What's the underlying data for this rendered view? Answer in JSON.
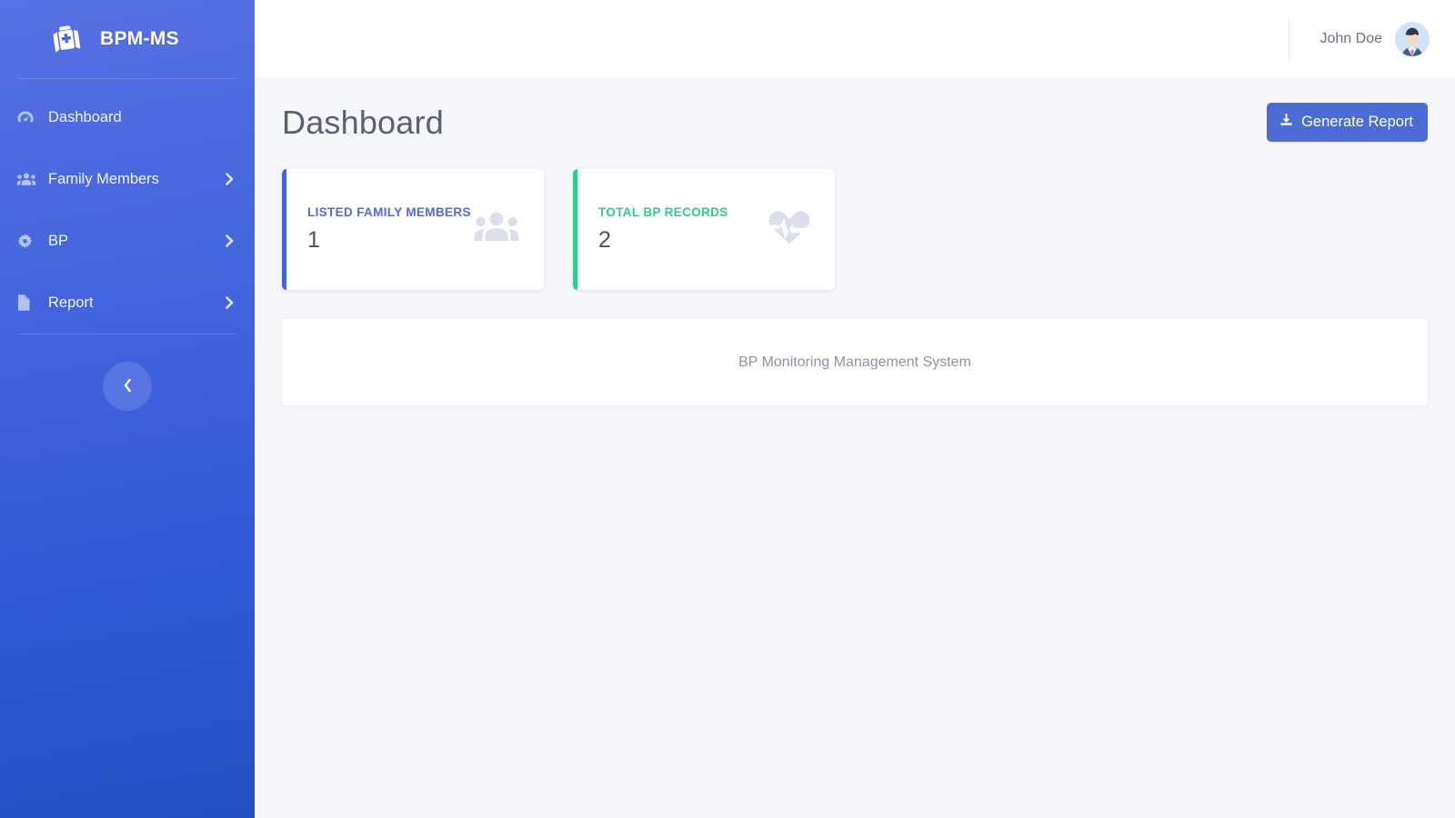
{
  "brand": {
    "title": "BPM-MS",
    "logo_icon": "medical-kit-icon"
  },
  "sidebar": {
    "items": [
      {
        "label": "Dashboard",
        "icon": "tachometer-icon",
        "has_caret": false
      },
      {
        "label": "Family Members",
        "icon": "users-group-icon",
        "has_caret": true
      },
      {
        "label": "BP",
        "icon": "gear-icon",
        "has_caret": true
      },
      {
        "label": "Report",
        "icon": "file-icon",
        "has_caret": true
      }
    ],
    "collapse_icon": "chevron-left-icon"
  },
  "topbar": {
    "user_name": "John Doe",
    "avatar_icon": "user-avatar"
  },
  "page": {
    "title": "Dashboard",
    "generate_report_label": "Generate Report",
    "generate_report_icon": "download-icon"
  },
  "cards": [
    {
      "label": "LISTED FAMILY MEMBERS",
      "value": "1",
      "accent": "#4466dd",
      "label_color": "#4c6ddb",
      "icon": "users-group-icon"
    },
    {
      "label": "TOTAL BP RECORDS",
      "value": "2",
      "accent": "#2bce8c",
      "label_color": "#2bce8c",
      "icon": "heart-pulse-icon"
    }
  ],
  "panel": {
    "text": "BP Monitoring Management System"
  },
  "colors": {
    "sidebar_top": "#5871e3",
    "sidebar_bottom": "#2450c4",
    "button_primary": "#4a6cd4",
    "page_background": "#f6f7fb",
    "card_blue": "#4466dd",
    "card_green": "#2bce8c"
  }
}
